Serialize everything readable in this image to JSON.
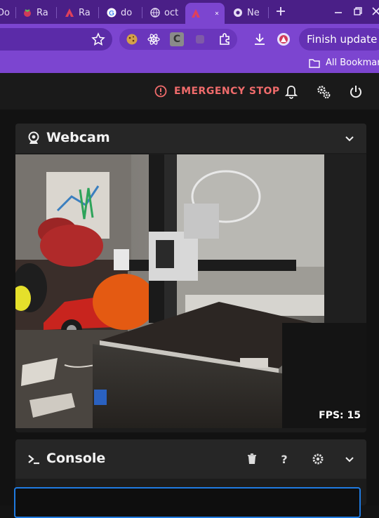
{
  "browser": {
    "tabs": [
      {
        "label": "Do",
        "icon": "document-icon"
      },
      {
        "label": "Ra",
        "icon": "raspberry-icon"
      },
      {
        "label": "Ra",
        "icon": "mainsail-icon"
      },
      {
        "label": "do",
        "icon": "google-icon"
      },
      {
        "label": "oct",
        "icon": "globe-icon"
      },
      {
        "label": "",
        "icon": "mainsail-icon",
        "active": true
      },
      {
        "label": "Ne",
        "icon": "chrome-icon"
      }
    ],
    "finish_update_label": "Finish update",
    "bookmarks_label": "All Bookmark",
    "extension_c_label": "C"
  },
  "app": {
    "emergency_stop_label": "EMERGENCY STOP",
    "accent_danger": "#ef6b6b"
  },
  "webcam": {
    "title": "Webcam",
    "fps_label": "FPS: 15"
  },
  "console": {
    "title": "Console",
    "input_value": ""
  },
  "colors": {
    "browser_frame": "#4a1f87",
    "browser_toolbar": "#7c45d0",
    "app_background": "#121212",
    "input_focus": "#1f7ae0"
  }
}
